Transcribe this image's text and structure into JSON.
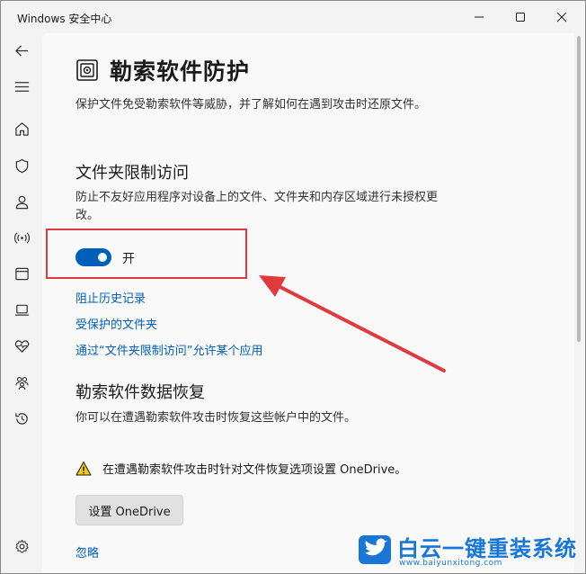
{
  "window": {
    "title": "Windows 安全中心"
  },
  "nav": {
    "items": [
      {
        "icon": "back-arrow-icon"
      },
      {
        "icon": "hamburger-menu-icon"
      },
      {
        "icon": "home-icon"
      },
      {
        "icon": "shield-icon"
      },
      {
        "icon": "person-icon"
      },
      {
        "icon": "wireless-icon"
      },
      {
        "icon": "app-browser-icon"
      },
      {
        "icon": "laptop-icon"
      },
      {
        "icon": "heart-pulse-icon"
      },
      {
        "icon": "family-icon"
      },
      {
        "icon": "history-icon"
      },
      {
        "icon": "settings-gear-icon"
      }
    ]
  },
  "page": {
    "title": "勒索软件防护",
    "description": "保护文件免受勒索软件等威胁，并了解如何在遇到攻击时还原文件。"
  },
  "folder_access": {
    "title": "文件夹限制访问",
    "description_line1": "防止不友好应用程序对设备上的文件、文件夹和内存区域进行未授权更",
    "description_line2": "改。",
    "toggle_label": "开",
    "toggle_on": true,
    "links": [
      "阻止历史记录",
      "受保护的文件夹",
      "通过“文件夹限制访问”允许某个应用"
    ]
  },
  "recovery": {
    "title": "勒索软件数据恢复",
    "description": "你可以在遭遇勒索软件攻击时恢复这些帐户中的文件。",
    "warning": "在遭遇勒索软件攻击时针对文件恢复选项设置 OneDrive。",
    "button_label": "设置 OneDrive",
    "dismiss_link": "忽略"
  },
  "watermark": {
    "text": "白云一键重装系统",
    "url": "www.baiyunxitong.com"
  },
  "colors": {
    "accent": "#005fb8",
    "highlight": "#e0393e",
    "watermark": "#1877d6"
  }
}
